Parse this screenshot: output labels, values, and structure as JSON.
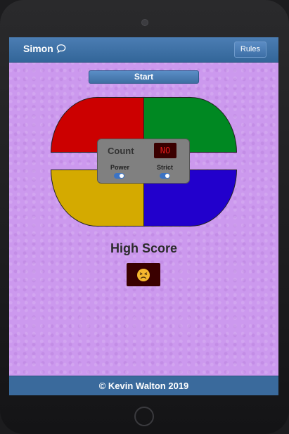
{
  "navbar": {
    "brand": "Simon",
    "brand_icon": "speech-bubble-icon",
    "rules_label": "Rules"
  },
  "controls": {
    "start_label": "Start"
  },
  "board": {
    "colors": {
      "red": "#cc0000",
      "green": "#008822",
      "yellow": "#d4aa00",
      "blue": "#2200cc"
    },
    "count_label": "Count",
    "count_value": "NO",
    "power_label": "Power",
    "strict_label": "Strict",
    "power_on": true,
    "strict_on": true
  },
  "score": {
    "heading": "High Score",
    "icon": "frowning-face-icon"
  },
  "footer": {
    "text": "© Kevin Walton 2019"
  },
  "theme": {
    "nav_color": "#336699",
    "background": "#cc99ee",
    "accent": "#3b73c4"
  }
}
